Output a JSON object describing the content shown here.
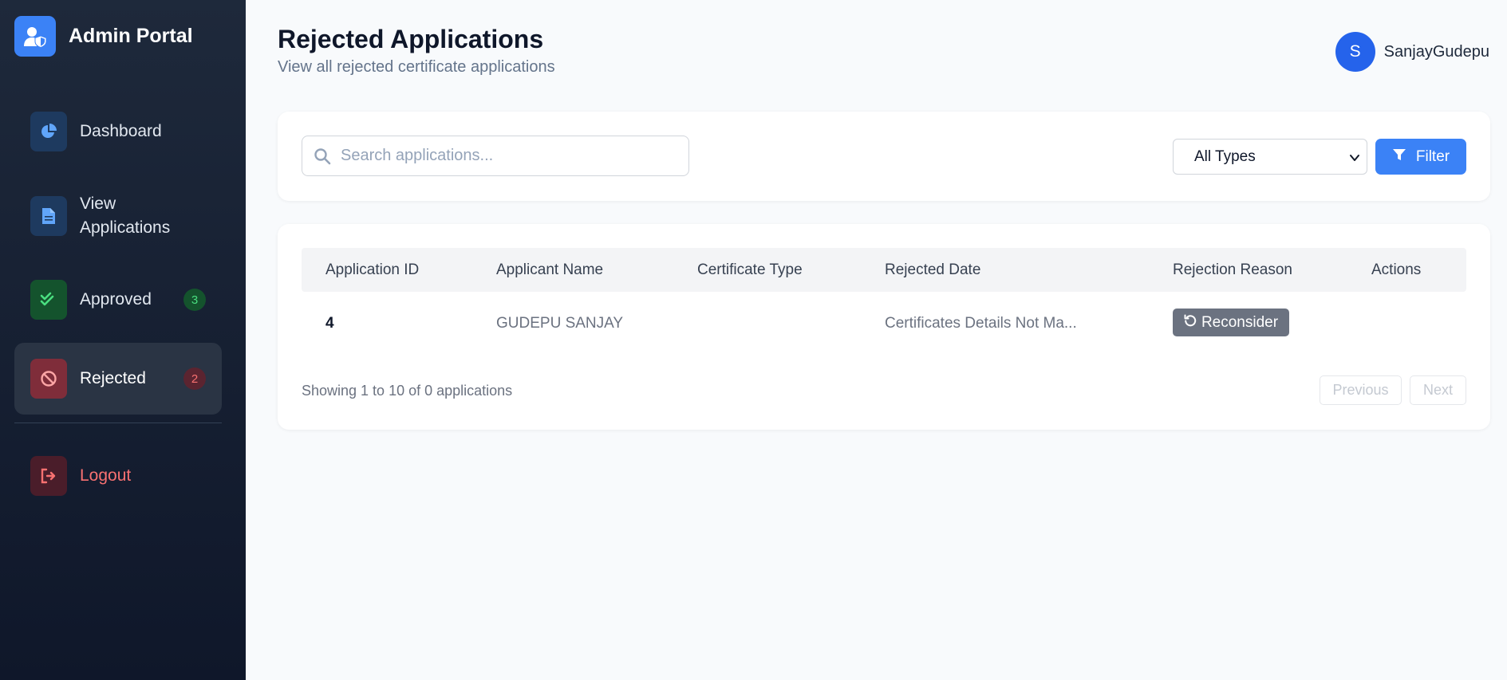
{
  "sidebar": {
    "brand": {
      "title": "Admin Portal",
      "icon": "user-shield-icon"
    },
    "items": [
      {
        "label": "Dashboard",
        "icon": "pie-chart-icon"
      },
      {
        "label_line1": "View",
        "label_line2": "Applications",
        "icon": "file-icon"
      },
      {
        "label": "Approved",
        "icon": "check-double-icon",
        "badge": "3"
      },
      {
        "label": "Rejected",
        "icon": "ban-icon",
        "badge": "2"
      },
      {
        "label": "Logout",
        "icon": "sign-out-icon"
      }
    ]
  },
  "header": {
    "title": "Rejected Applications",
    "subtitle": "View all rejected certificate applications",
    "user": {
      "initial": "S",
      "name": "SanjayGudepu"
    }
  },
  "search": {
    "placeholder": "Search applications...",
    "type_selected": "All Types",
    "filter_label": "Filter"
  },
  "table": {
    "columns": [
      "Application ID",
      "Applicant Name",
      "Certificate Type",
      "Rejected Date",
      "Rejection Reason",
      "Actions"
    ],
    "rows": [
      {
        "id": "4",
        "name": "GUDEPU SANJAY",
        "certificate_type": "",
        "rejected_date": "Certificates Details Not Ma...",
        "action_label": "Reconsider"
      }
    ],
    "showing_text": "Showing 1 to 10 of 0 applications",
    "prev_label": "Previous",
    "next_label": "Next"
  },
  "colors": {
    "accent": "#3b82f6",
    "sidebar_bg": "#0f172a",
    "approved": "#22c55e",
    "rejected": "#ef4444"
  }
}
